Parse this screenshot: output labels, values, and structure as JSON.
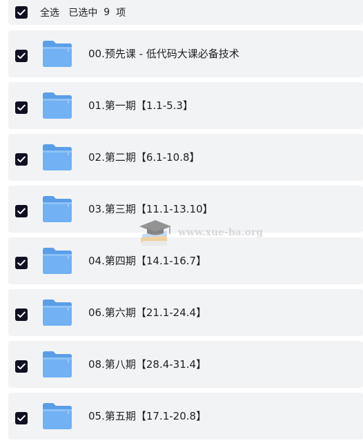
{
  "select_all": {
    "label": "全选",
    "selected_prefix": "已选中",
    "selected_count": "9",
    "selected_suffix": "项",
    "checked": true
  },
  "folders": [
    {
      "name": "00.预先课 - 低代码大课必备技术",
      "checked": true,
      "icon": "folder-icon"
    },
    {
      "name": "01.第一期【1.1-5.3】",
      "checked": true,
      "icon": "folder-icon"
    },
    {
      "name": "02.第二期【6.1-10.8】",
      "checked": true,
      "icon": "folder-icon"
    },
    {
      "name": "03.第三期【11.1-13.10】",
      "checked": true,
      "icon": "folder-icon"
    },
    {
      "name": "04.第四期【14.1-16.7】",
      "checked": true,
      "icon": "folder-icon"
    },
    {
      "name": "06.第六期【21.1-24.4】",
      "checked": true,
      "icon": "folder-icon"
    },
    {
      "name": "08.第八期【28.4-31.4】",
      "checked": true,
      "icon": "folder-icon"
    },
    {
      "name": "05.第五期【17.1-20.8】",
      "checked": true,
      "icon": "folder-icon"
    }
  ],
  "watermark": {
    "text": "www.xue-ba.org",
    "icon": "graduation-cap-icon"
  },
  "colors": {
    "checkbox": "#0f1021",
    "row_background": "#f2f3f5",
    "folder_blue": "#6aaaf0",
    "text": "#1f1f1f"
  }
}
